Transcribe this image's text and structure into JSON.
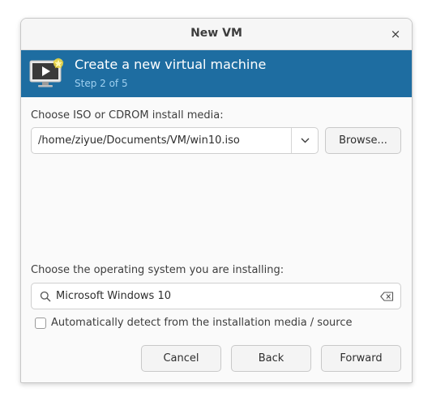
{
  "window": {
    "title": "New VM",
    "close_glyph": "×"
  },
  "banner": {
    "icon": "vm-monitor-play-icon",
    "title": "Create a new virtual machine",
    "step": "Step 2 of 5",
    "background_color": "#1e6da1"
  },
  "install_media": {
    "label": "Choose ISO or CDROM install media:",
    "selected_value": "/home/ziyue/Documents/VM/win10.iso",
    "browse_label": "Browse..."
  },
  "os_selection": {
    "label": "Choose the operating system you are installing:",
    "search_value": "Microsoft Windows 10",
    "auto_detect_label": "Automatically detect from the installation media / source",
    "auto_detect_checked": false
  },
  "footer": {
    "cancel_label": "Cancel",
    "back_label": "Back",
    "forward_label": "Forward"
  }
}
